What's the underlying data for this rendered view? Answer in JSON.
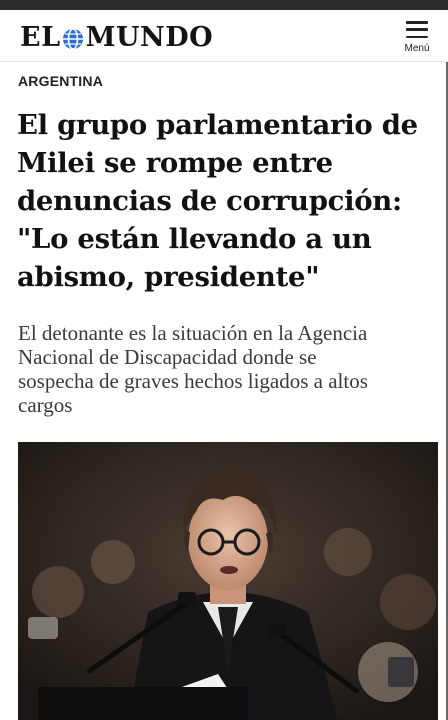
{
  "header": {
    "logo_left": "EL",
    "logo_right": "MUNDO",
    "menu_label": "Menú"
  },
  "article": {
    "section": "ARGENTINA",
    "headline_lines": [
      "El grupo parlamentario de",
      "Milei se rompe entre",
      "denuncias de corrupción:",
      "\"Lo están llevando a un",
      "abismo, presidente\""
    ],
    "subhead_lines": [
      "El detonante es la situación en la Agencia",
      "Nacional de Discapacidad donde se",
      "sospecha de graves hechos ligados a altos",
      "cargos"
    ]
  },
  "colors": {
    "logo_globe": "#2a6fd6",
    "text": "#111111",
    "subhead": "#3a3a3a"
  }
}
